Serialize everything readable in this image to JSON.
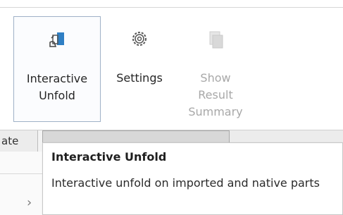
{
  "ribbon": {
    "buttons": [
      {
        "label_line1": "Interactive",
        "label_line2": "Unfold",
        "icon": "interactive-unfold-icon",
        "enabled": true
      },
      {
        "label_line1": "Settings",
        "icon": "gear-icon",
        "enabled": true
      },
      {
        "label_line1": "Show",
        "label_line2": "Result",
        "label_line3": "Summary",
        "icon": "show-result-summary-icon",
        "enabled": false
      }
    ]
  },
  "tabs": {
    "partial_label": "ate"
  },
  "tooltip": {
    "title": "Interactive Unfold",
    "description": "Interactive unfold on imported and native parts"
  },
  "colors": {
    "accent_blue": "#2f7fc4",
    "disabled_text": "#a8a8a8",
    "button_border": "#9fb1c7"
  }
}
